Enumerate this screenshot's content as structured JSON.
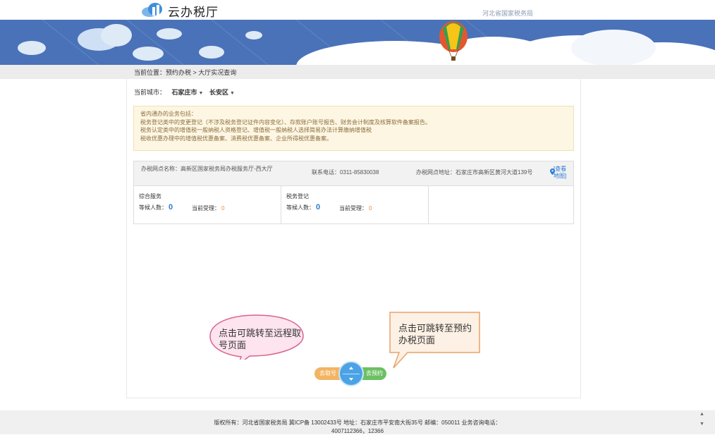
{
  "header": {
    "app_title": "云办税厅",
    "bureau": "河北省国家税务局",
    "logo_icon": "cloud-logo-icon"
  },
  "breadcrumb": {
    "text": "当前位置：预约办税 > 大厅实况查询"
  },
  "city": {
    "label": "当前城市：",
    "city": "石家庄市",
    "district": "长安区"
  },
  "notice": {
    "lines": [
      "省内通办的业务包括：",
      "税务登记类中的变更登记（不涉及税务登记证件内容变化）、存款账户账号报告、财务会计制度及核算软件备案报告。",
      "税务认定类中的增值税一般纳税人资格登记、增值税一般纳税人选择简易办法计算缴纳增值税",
      "税收优惠办理中的增值税优惠备案、消费税优惠备案、企业所得税优惠备案。"
    ]
  },
  "office": {
    "name": "办税网点名称：高新区国家税务局办税服务厅-西大厅",
    "phone": "联系电话：0311-85830038",
    "address": "办税网点地址：石家庄市高新区黄河大道139号",
    "map_link": "[查看地图]",
    "services": [
      {
        "name": "综合服务",
        "wait_label": "等候人数：",
        "wait": "0",
        "proc_label": "当前受理：",
        "proc": "0"
      },
      {
        "name": "税务登记",
        "wait_label": "等候人数：",
        "wait": "0",
        "proc_label": "当前受理：",
        "proc": "0"
      }
    ]
  },
  "callouts": {
    "left": "点击可跳转至远程取号页面",
    "right": "点击可跳转至预约办税页面"
  },
  "buttons": {
    "queue": "去取号",
    "reserve": "去预约"
  },
  "footer": {
    "line1": "版权所有：河北省国家税务局  冀ICP备 13002433号    地址：石家庄市平安南大街35号  邮编：050011  业务咨询电话：",
    "line2": "4007112366，12366"
  },
  "colors": {
    "banner_blue": "#4a72b8",
    "accent_blue": "#2a7bd6",
    "notice_bg": "#fdf6e3",
    "queue_orange": "#f3b463",
    "reserve_green": "#6cc063"
  }
}
